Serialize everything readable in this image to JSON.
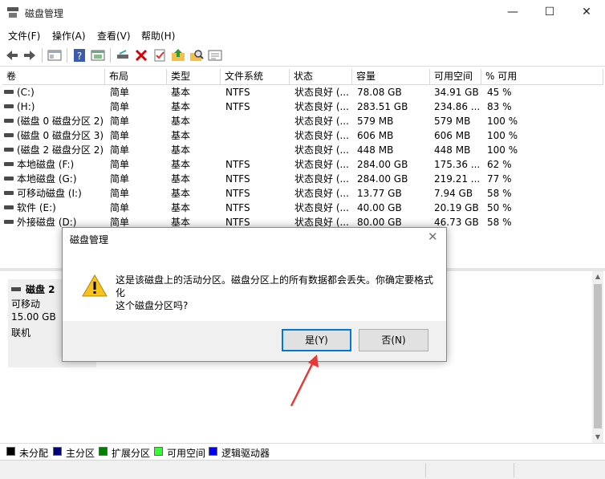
{
  "window": {
    "title": "磁盘管理",
    "min_glyph": "—",
    "max_glyph": "☐",
    "close_glyph": "✕"
  },
  "menu": [
    "文件(F)",
    "操作(A)",
    "查看(V)",
    "帮助(H)"
  ],
  "toolbar_icons": [
    "back-arrow-icon",
    "forward-arrow-icon",
    "console-tree-icon",
    "help-icon",
    "properties-icon",
    "connect-disk-icon",
    "delete-icon",
    "check-icon",
    "folder-up-icon",
    "find-icon",
    "settings-icon"
  ],
  "table": {
    "columns": [
      "卷",
      "布局",
      "类型",
      "文件系统",
      "状态",
      "容量",
      "可用空间",
      "% 可用"
    ],
    "rows": [
      [
        "(C:)",
        "简单",
        "基本",
        "NTFS",
        "状态良好 (...",
        "78.08 GB",
        "34.91 GB",
        "45 %"
      ],
      [
        "(H:)",
        "简单",
        "基本",
        "NTFS",
        "状态良好 (...",
        "283.51 GB",
        "234.86 ...",
        "83 %"
      ],
      [
        "(磁盘 0 磁盘分区 2)",
        "简单",
        "基本",
        "",
        "状态良好 (...",
        "579 MB",
        "579 MB",
        "100 %"
      ],
      [
        "(磁盘 0 磁盘分区 3)",
        "简单",
        "基本",
        "",
        "状态良好 (...",
        "606 MB",
        "606 MB",
        "100 %"
      ],
      [
        "(磁盘 2 磁盘分区 2)",
        "简单",
        "基本",
        "",
        "状态良好 (...",
        "448 MB",
        "448 MB",
        "100 %"
      ],
      [
        "本地磁盘 (F:)",
        "简单",
        "基本",
        "NTFS",
        "状态良好 (...",
        "284.00 GB",
        "175.36 ...",
        "62 %"
      ],
      [
        "本地磁盘 (G:)",
        "简单",
        "基本",
        "NTFS",
        "状态良好 (...",
        "284.00 GB",
        "219.21 ...",
        "77 %"
      ],
      [
        "可移动磁盘 (I:)",
        "简单",
        "基本",
        "NTFS",
        "状态良好 (...",
        "13.77 GB",
        "7.94 GB",
        "58 %"
      ],
      [
        "软件 (E:)",
        "简单",
        "基本",
        "NTFS",
        "状态良好 (...",
        "40.00 GB",
        "20.19 GB",
        "50 %"
      ],
      [
        "外接磁盘 (D:)",
        "简单",
        "基本",
        "NTFS",
        "状态良好 (...",
        "80.00 GB",
        "46.73 GB",
        "58 %"
      ]
    ]
  },
  "disk": {
    "name": "磁盘 2",
    "type": "可移动",
    "size": "15.00 GB",
    "status": "联机"
  },
  "legend": [
    {
      "label": "未分配",
      "color": "#000000"
    },
    {
      "label": "主分区",
      "color": "#000080"
    },
    {
      "label": "扩展分区",
      "color": "#008000"
    },
    {
      "label": "可用空间",
      "color": "#33ff33"
    },
    {
      "label": "逻辑驱动器",
      "color": "#0000ff"
    }
  ],
  "dialog": {
    "title": "磁盘管理",
    "close_glyph": "✕",
    "message_line1": "这是该磁盘上的活动分区。磁盘分区上的所有数据都会丢失。你确定要格式化",
    "message_line2": "这个磁盘分区吗?",
    "yes_label": "是(Y)",
    "no_label": "否(N)",
    "icon": "warning-icon"
  },
  "annotation": {
    "color": "#e53935",
    "icon": "red-arrow"
  }
}
